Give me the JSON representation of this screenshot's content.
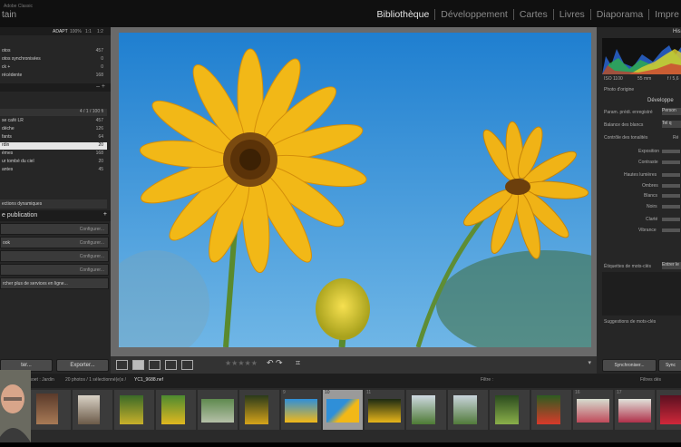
{
  "app": {
    "brand_line1": "Adobe Classic",
    "brand_line2": "tain",
    "modules": [
      "Bibliothèque",
      "Développement",
      "Cartes",
      "Livres",
      "Diaporama",
      "Impre"
    ]
  },
  "left_panel": {
    "header": {
      "label": "ADAPT",
      "options": [
        "100%",
        "1:1",
        "1:2"
      ]
    },
    "catalog_rows": [
      {
        "label": "otos",
        "count": "457"
      },
      {
        "label": "otos synchronisées",
        "count": "0"
      },
      {
        "label": "ck +",
        "count": "0"
      },
      {
        "label": "récédente",
        "count": "168"
      }
    ],
    "collection_filter": "4 / 1 / 100 fi",
    "collections": [
      {
        "label": "se café LR",
        "count": "457",
        "selected": false
      },
      {
        "label": "déche",
        "count": "126",
        "selected": false
      },
      {
        "label": "fants",
        "count": "64",
        "selected": false
      },
      {
        "label": "rdin",
        "count": "20",
        "selected": true
      },
      {
        "label": "émes",
        "count": "168",
        "selected": false
      },
      {
        "label": "ur tombé du ciel",
        "count": "20",
        "selected": false
      },
      {
        "label": "antes",
        "count": "45",
        "selected": false
      }
    ],
    "dynamic_collections": "ections dynamiques",
    "publish_header": "e publication",
    "services": [
      {
        "label": "",
        "action": "Configurer..."
      },
      {
        "label": "ook",
        "action": "Configurer..."
      },
      {
        "label": "",
        "action": "Configurer..."
      },
      {
        "label": "",
        "action": "Configurer..."
      }
    ],
    "find_more": "rcher plus de services en ligne...",
    "import_label": "ter...",
    "export_label": "Exporter..."
  },
  "toolbar": {
    "rating_stars": "★★★★★"
  },
  "right_panel": {
    "histogram_title": "His",
    "histogram_info": [
      "ISO 1100",
      "55 mm",
      "f / 5,6"
    ],
    "original_photo": "Photo d'origine",
    "develop_title": "Développe",
    "preset_label": "Param. prédi. enregistré",
    "preset_value": "Person",
    "wb_label": "Balance des blancs",
    "wb_value": "Tel q",
    "tone_label": "Contrôle des tonalités",
    "tone_value": "Ré",
    "sliders": [
      "Exposition",
      "Contraste",
      "Hautes lumières",
      "Ombres",
      "Blancs",
      "Noirs",
      "Clarté",
      "Vibrance"
    ],
    "keywords_label": "Étiquettes de mots-clés",
    "keywords_value": "Entrer le",
    "suggestions_label": "Suggestions de mots-clés",
    "sync_button": "Synchroniser...",
    "sync_meta_button": "Sync"
  },
  "filmstrip_bar": {
    "source": "ssoet : Jardin",
    "count_text": "20 photos / 1 sélectionné(e)s /",
    "filename": "YC1_9688.nef",
    "filter_label": "Filtre :",
    "filter_value": "Filtres dés"
  },
  "filmstrip": {
    "selected_number": "10",
    "numbers": [
      "1",
      "2",
      "3",
      "4",
      "5",
      "6",
      "7",
      "8",
      "9",
      "10",
      "11",
      "12",
      "13",
      "14",
      "15",
      "16",
      "17",
      "18"
    ]
  },
  "colors": {
    "accent_selected": "#e6e6e6",
    "sky": "#2f8fd8",
    "petal": "#f2b817"
  }
}
